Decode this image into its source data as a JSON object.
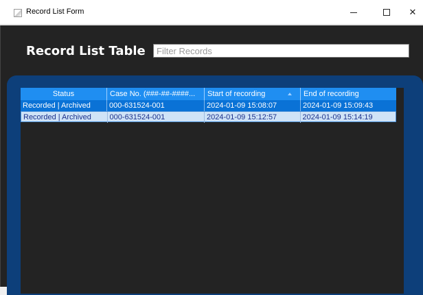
{
  "window": {
    "title": "Record List Form",
    "minimize_glyph": "minimize-icon",
    "maximize_glyph": "maximize-icon",
    "close_glyph": "✕"
  },
  "header": {
    "title": "Record List Table",
    "filter_placeholder": "Filter Records",
    "filter_value": ""
  },
  "colors": {
    "app_background": "#232323",
    "panel": "#0d3f7a",
    "header_row": "#1f8ef1",
    "selected_row": "#0a72d6",
    "alt_row": "#cfe3f7"
  },
  "table": {
    "columns": [
      {
        "label": "Status"
      },
      {
        "label": "Case No. (###-##-####..."
      },
      {
        "label": "Start of recording",
        "sorted": "ascending"
      },
      {
        "label": "End of recording"
      }
    ],
    "rows": [
      {
        "status": "Recorded | Archived",
        "case_no": "000-631524-001",
        "start": "2024-01-09 15:08:07",
        "end": "2024-01-09 15:09:43",
        "selected": true
      },
      {
        "status": "Recorded | Archived",
        "case_no": "000-631524-001",
        "start": "2024-01-09 15:12:57",
        "end": "2024-01-09 15:14:19",
        "selected": false
      }
    ]
  }
}
